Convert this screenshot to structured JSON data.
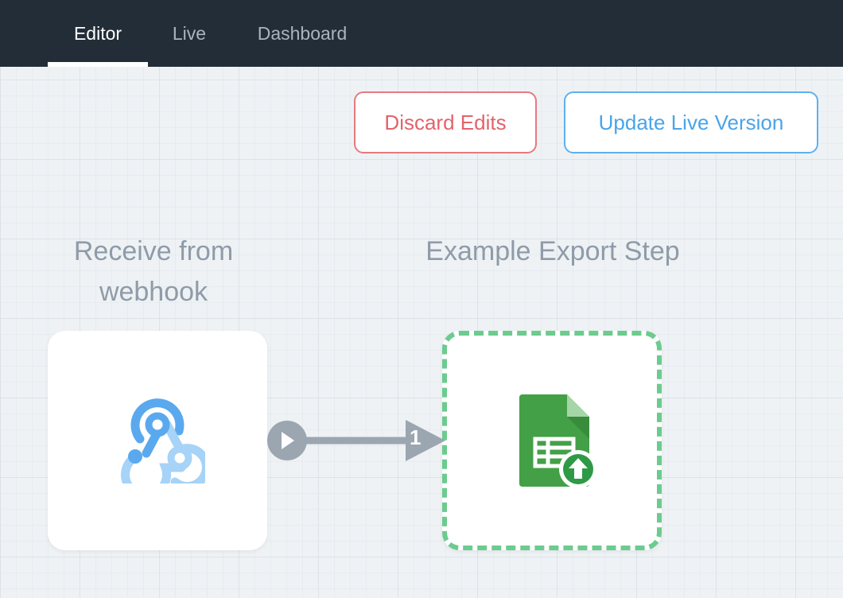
{
  "nav": {
    "tabs": [
      {
        "label": "Editor",
        "active": true
      },
      {
        "label": "Live",
        "active": false
      },
      {
        "label": "Dashboard",
        "active": false
      }
    ]
  },
  "toolbar": {
    "discard_label": "Discard Edits",
    "update_label": "Update Live Version"
  },
  "steps": [
    {
      "title": "Receive from webhook",
      "icon": "webhook-icon"
    },
    {
      "title": "Example Export Step",
      "icon": "google-sheets-export-icon"
    }
  ],
  "connector": {
    "label": "1",
    "icon": "play-icon"
  },
  "colors": {
    "nav_bg": "#222d38",
    "discard": "#e3636b",
    "update": "#4aa4e8",
    "selected_border": "#6ccb8e",
    "connector": "#9ba6b0"
  }
}
